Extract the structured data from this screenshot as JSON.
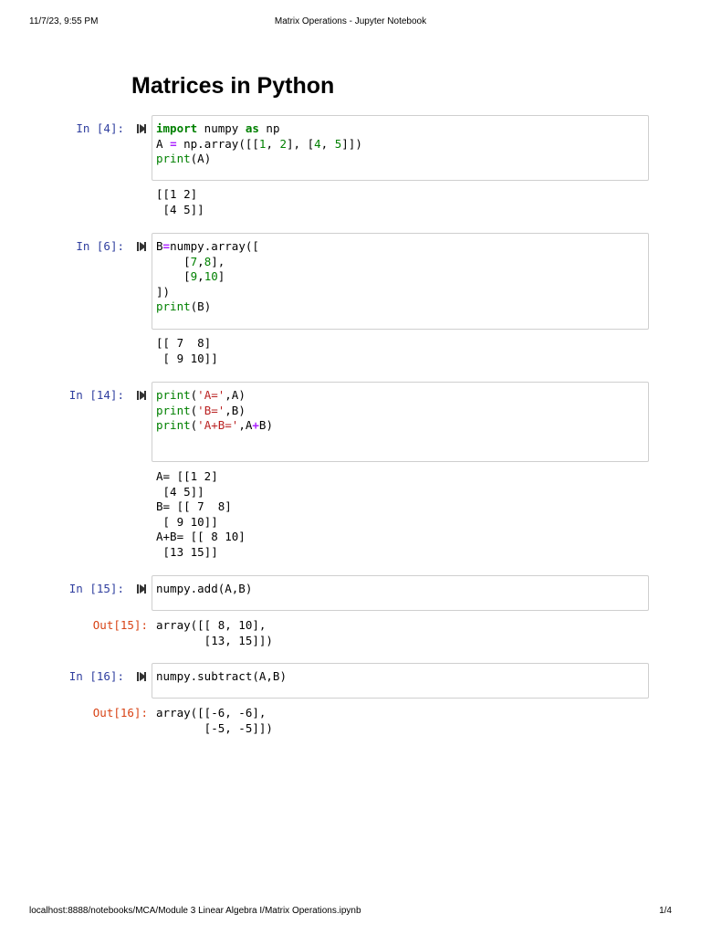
{
  "header": {
    "date": "11/7/23, 9:55 PM",
    "title": "Matrix Operations - Jupyter Notebook"
  },
  "footer": {
    "url": "localhost:8888/notebooks/MCA/Module 3 Linear Algebra I/Matrix Operations.ipynb",
    "page": "1/4"
  },
  "notebook": {
    "title": "Matrices in Python"
  },
  "cells": [
    {
      "prompt": "In [4]:",
      "code": [
        [
          [
            "kw",
            "import"
          ],
          [
            "t",
            " numpy "
          ],
          [
            "kw",
            "as"
          ],
          [
            "t",
            " np"
          ]
        ],
        [
          [
            "t",
            "A "
          ],
          [
            "op",
            "="
          ],
          [
            "t",
            " np.array([["
          ],
          [
            "num",
            "1"
          ],
          [
            "t",
            ", "
          ],
          [
            "num",
            "2"
          ],
          [
            "t",
            "], ["
          ],
          [
            "num",
            "4"
          ],
          [
            "t",
            ", "
          ],
          [
            "num",
            "5"
          ],
          [
            "t",
            "]])"
          ]
        ],
        [
          [
            "bi",
            "print"
          ],
          [
            "t",
            "(A)"
          ]
        ]
      ],
      "output": [
        "[[1 2]",
        " [4 5]]"
      ]
    },
    {
      "prompt": "In [6]:",
      "code": [
        [
          [
            "t",
            "B"
          ],
          [
            "op",
            "="
          ],
          [
            "t",
            "numpy.array(["
          ]
        ],
        [
          [
            "t",
            "    ["
          ],
          [
            "num",
            "7"
          ],
          [
            "t",
            ","
          ],
          [
            "num",
            "8"
          ],
          [
            "t",
            "],"
          ]
        ],
        [
          [
            "t",
            "    ["
          ],
          [
            "num",
            "9"
          ],
          [
            "t",
            ","
          ],
          [
            "num",
            "10"
          ],
          [
            "t",
            "]"
          ]
        ],
        [
          [
            "t",
            "])"
          ]
        ],
        [
          [
            "bi",
            "print"
          ],
          [
            "t",
            "(B)"
          ]
        ]
      ],
      "output": [
        "[[ 7  8]",
        " [ 9 10]]"
      ]
    },
    {
      "prompt": "In [14]:",
      "code": [
        [
          [
            "bi",
            "print"
          ],
          [
            "t",
            "("
          ],
          [
            "str",
            "'A='"
          ],
          [
            "t",
            ",A)"
          ]
        ],
        [
          [
            "bi",
            "print"
          ],
          [
            "t",
            "("
          ],
          [
            "str",
            "'B='"
          ],
          [
            "t",
            ",B)"
          ]
        ],
        [
          [
            "bi",
            "print"
          ],
          [
            "t",
            "("
          ],
          [
            "str",
            "'A+B='"
          ],
          [
            "t",
            ",A"
          ],
          [
            "op",
            "+"
          ],
          [
            "t",
            "B)"
          ]
        ],
        [
          [
            "t",
            ""
          ]
        ]
      ],
      "output": [
        "A= [[1 2]",
        " [4 5]]",
        "B= [[ 7  8]",
        " [ 9 10]]",
        "A+B= [[ 8 10]",
        " [13 15]]"
      ]
    },
    {
      "prompt": "In [15]:",
      "code": [
        [
          [
            "t",
            "numpy.add(A,B)"
          ]
        ]
      ],
      "out_prompt": "Out[15]:",
      "output": [
        "array([[ 8, 10],",
        "       [13, 15]])"
      ]
    },
    {
      "prompt": "In [16]:",
      "code": [
        [
          [
            "t",
            "numpy.subtract(A,B)"
          ]
        ]
      ],
      "out_prompt": "Out[16]:",
      "output": [
        "array([[-6, -6],",
        "       [-5, -5]])"
      ]
    }
  ]
}
